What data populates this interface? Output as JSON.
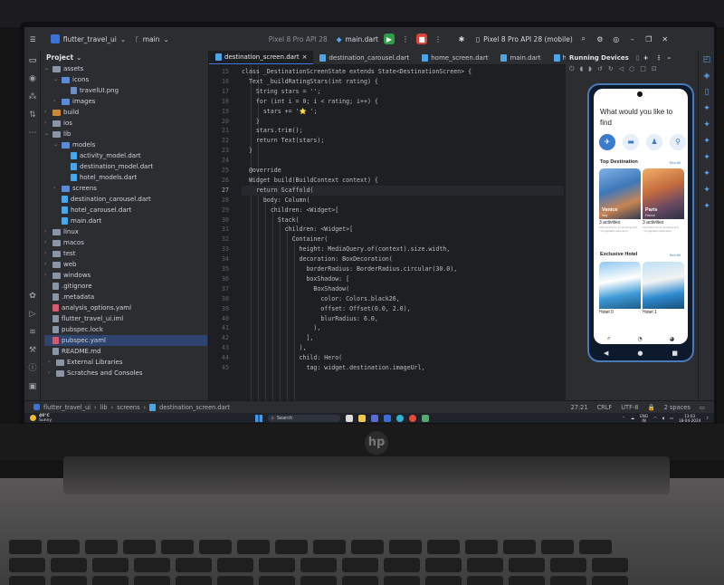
{
  "ide": {
    "project_name": "flutter_travel_ui",
    "branch": "main",
    "device_selector": "Pixel 8 Pro API 28",
    "run_config": "main.dart",
    "device_selector_right": "Pixel 8 Pro API 28 (mobile)"
  },
  "project_panel": {
    "title": "Project",
    "tree": [
      {
        "label": "assets",
        "kind": "folder",
        "depth": 0,
        "expanded": true
      },
      {
        "label": "icons",
        "kind": "folder",
        "depth": 1,
        "expanded": true
      },
      {
        "label": "travelUI.png",
        "kind": "png",
        "depth": 2
      },
      {
        "label": "images",
        "kind": "folder",
        "depth": 1,
        "expanded": false
      },
      {
        "label": "build",
        "kind": "folder-orange",
        "depth": 0,
        "expanded": false
      },
      {
        "label": "ios",
        "kind": "folder",
        "depth": 0,
        "expanded": false
      },
      {
        "label": "lib",
        "kind": "folder",
        "depth": 0,
        "expanded": true
      },
      {
        "label": "models",
        "kind": "folder",
        "depth": 1,
        "expanded": true
      },
      {
        "label": "activity_model.dart",
        "kind": "dart",
        "depth": 2
      },
      {
        "label": "destination_model.dart",
        "kind": "dart",
        "depth": 2
      },
      {
        "label": "hotel_models.dart",
        "kind": "dart",
        "depth": 2
      },
      {
        "label": "screens",
        "kind": "folder",
        "depth": 1,
        "expanded": false
      },
      {
        "label": "destination_carousel.dart",
        "kind": "dart",
        "depth": 1
      },
      {
        "label": "hotel_carousel.dart",
        "kind": "dart",
        "depth": 1
      },
      {
        "label": "main.dart",
        "kind": "dart",
        "depth": 1
      },
      {
        "label": "linux",
        "kind": "folder",
        "depth": 0,
        "expanded": false
      },
      {
        "label": "macos",
        "kind": "folder",
        "depth": 0,
        "expanded": false
      },
      {
        "label": "test",
        "kind": "folder",
        "depth": 0,
        "expanded": false
      },
      {
        "label": "web",
        "kind": "folder",
        "depth": 0,
        "expanded": false
      },
      {
        "label": "windows",
        "kind": "folder",
        "depth": 0,
        "expanded": false
      },
      {
        "label": ".gitignore",
        "kind": "plain",
        "depth": 0
      },
      {
        "label": ".metadata",
        "kind": "plain",
        "depth": 0
      },
      {
        "label": "analysis_options.yaml",
        "kind": "yaml",
        "depth": 0
      },
      {
        "label": "flutter_travel_ui.iml",
        "kind": "plain",
        "depth": 0
      },
      {
        "label": "pubspec.lock",
        "kind": "plain",
        "depth": 0
      },
      {
        "label": "pubspec.yaml",
        "kind": "yaml",
        "depth": 0,
        "selected": true
      },
      {
        "label": "README.md",
        "kind": "plain",
        "depth": 0
      },
      {
        "label": "External Libraries",
        "kind": "folder",
        "depth": -1,
        "expanded": false
      },
      {
        "label": "Scratches and Consoles",
        "kind": "folder",
        "depth": -1,
        "expanded": false
      }
    ]
  },
  "tabs": [
    {
      "label": "destination_screen.dart",
      "active": true
    },
    {
      "label": "destination_carousel.dart",
      "active": false
    },
    {
      "label": "home_screen.dart",
      "active": false
    },
    {
      "label": "main.dart",
      "active": false
    },
    {
      "label": "hote",
      "active": false
    }
  ],
  "editor": {
    "current_line": 27,
    "lines": [
      {
        "n": 15,
        "text": "class _DestinationScreenState extends State<DestinationScreen> {"
      },
      {
        "n": 16,
        "text": "  Text _buildRatingStars(int rating) {"
      },
      {
        "n": 17,
        "text": "    String stars = '';"
      },
      {
        "n": 18,
        "text": "    for (int i = 0; i < rating; i++) {"
      },
      {
        "n": 19,
        "text": "      stars += '⭐ ';"
      },
      {
        "n": 20,
        "text": "    }"
      },
      {
        "n": 21,
        "text": "    stars.trim();"
      },
      {
        "n": 22,
        "text": "    return Text(stars);"
      },
      {
        "n": 23,
        "text": "  }"
      },
      {
        "n": 24,
        "text": ""
      },
      {
        "n": 25,
        "text": "  @override"
      },
      {
        "n": 26,
        "text": "  Widget build(BuildContext context) {"
      },
      {
        "n": 27,
        "text": "    return Scaffold("
      },
      {
        "n": 28,
        "text": "      body: Column("
      },
      {
        "n": 29,
        "text": "        children: <Widget>["
      },
      {
        "n": 30,
        "text": "          Stack("
      },
      {
        "n": 31,
        "text": "            children: <Widget>["
      },
      {
        "n": 32,
        "text": "              Container("
      },
      {
        "n": 33,
        "text": "                height: MediaQuery.of(context).size.width,"
      },
      {
        "n": 34,
        "text": "                decoration: BoxDecoration("
      },
      {
        "n": 35,
        "text": "                  borderRadius: BorderRadius.circular(30.0),"
      },
      {
        "n": 36,
        "text": "                  boxShadow: ["
      },
      {
        "n": 37,
        "text": "                    BoxShadow("
      },
      {
        "n": 38,
        "text": "                      color: Colors.black26,"
      },
      {
        "n": 39,
        "text": "                      offset: Offset(0.0, 2.0),"
      },
      {
        "n": 40,
        "text": "                      blurRadius: 6.0,"
      },
      {
        "n": 41,
        "text": "                    ),"
      },
      {
        "n": 42,
        "text": "                  ],"
      },
      {
        "n": 43,
        "text": "                ),"
      },
      {
        "n": 44,
        "text": "                child: Hero("
      },
      {
        "n": 45,
        "text": "                  tag: widget.destination.imageUrl,"
      }
    ]
  },
  "running_devices": {
    "title": "Running Devices"
  },
  "phone": {
    "title": "What would you like to find",
    "top_destination": "Top Destination",
    "see_all": "See All",
    "destinations": [
      {
        "name": "Venice",
        "country": "Italy",
        "activities": "3 activities",
        "desc": "Visit Venice for an amazing and unforgettable adventure."
      },
      {
        "name": "Paris",
        "country": "France",
        "activities": "3 activities",
        "desc": "Visit Paris for an amazing and unforgettable adventure."
      }
    ],
    "exclusive_hotel": "Exclusive Hotel",
    "hotels": [
      {
        "name": "Hotel 0"
      },
      {
        "name": "Hotel 1"
      }
    ]
  },
  "statusbar": {
    "crumbs": [
      "flutter_travel_ui",
      "lib",
      "screens",
      "destination_screen.dart"
    ],
    "position": "27:21",
    "line_sep": "CRLF",
    "encoding": "UTF-8",
    "indent": "2 spaces"
  },
  "taskbar": {
    "temp": "40°C",
    "weather": "Sunny",
    "search": "Search",
    "lang": "ENG",
    "region": "IN",
    "time": "13:03",
    "date": "18-04-2024"
  },
  "brand": "hp"
}
